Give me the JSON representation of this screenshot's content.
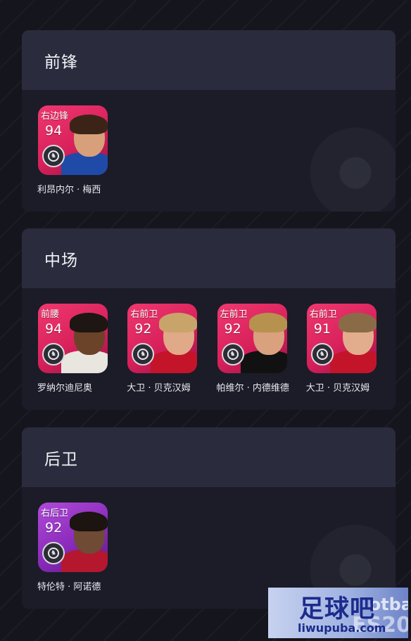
{
  "sections": [
    {
      "title": "前锋",
      "players": [
        {
          "position": "右边锋",
          "rating": "94",
          "name": "利昂内尔 · 梅西",
          "tile_color": "pink",
          "shirt": "#1f4aa8",
          "skin": "#d7a07a",
          "hair": "#3b2417"
        }
      ]
    },
    {
      "title": "中场",
      "players": [
        {
          "position": "前腰",
          "rating": "94",
          "name": "罗纳尔迪尼奥",
          "tile_color": "pink",
          "shirt": "#e9e6df",
          "skin": "#6b4329",
          "hair": "#1e1612"
        },
        {
          "position": "右前卫",
          "rating": "92",
          "name": "大卫 · 贝克汉姆",
          "tile_color": "pink",
          "shirt": "#c3142a",
          "skin": "#e0a987",
          "hair": "#c9a46a"
        },
        {
          "position": "左前卫",
          "rating": "92",
          "name": "帕维尔 · 内德维德",
          "tile_color": "pink",
          "shirt": "#111111",
          "skin": "#d9a17d",
          "hair": "#b7924e"
        },
        {
          "position": "右前卫",
          "rating": "91",
          "name": "大卫 · 贝克汉姆",
          "tile_color": "pink",
          "shirt": "#c3142a",
          "skin": "#e2ad8c",
          "hair": "#8a6b47"
        }
      ]
    },
    {
      "title": "后卫",
      "players": [
        {
          "position": "右后卫",
          "rating": "92",
          "name": "特伦特 · 阿诺德",
          "tile_color": "purple",
          "shirt": "#b4172e",
          "skin": "#6f4a35",
          "hair": "#1b1410"
        }
      ]
    }
  ],
  "watermark": {
    "big": "足球吧",
    "small": "liwupuba.com",
    "right_top": "otba",
    "right_bottom": "ES20"
  },
  "colors": {
    "page_bg": "#15151d",
    "section_bg": "#1b1c28",
    "header_bg": "#2a2b3d",
    "pink_tile": "#e22b63",
    "purple_tile": "#9a36c8"
  }
}
